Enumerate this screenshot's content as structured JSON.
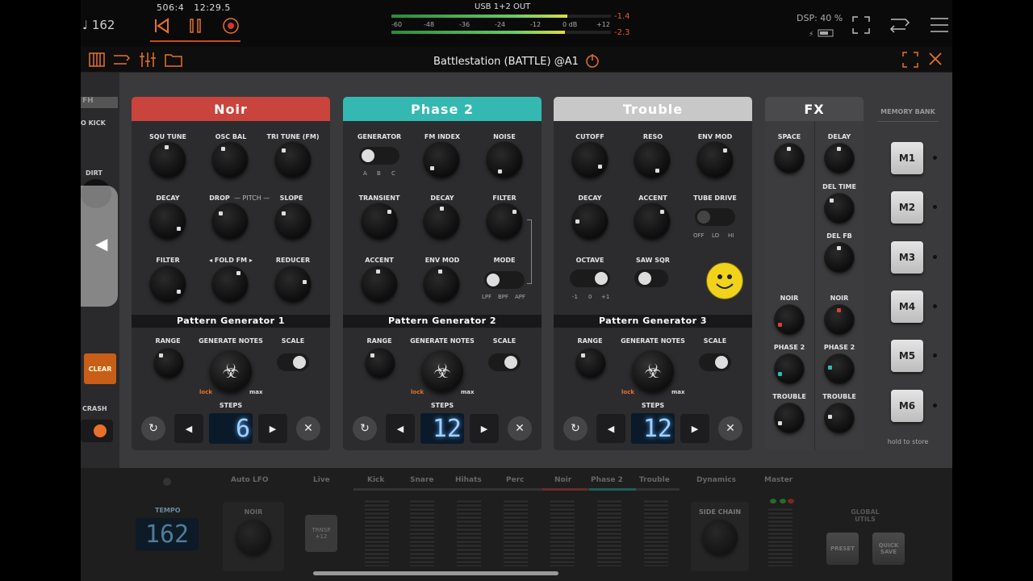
{
  "topbar": {
    "tempo": "♩ 162",
    "position": "506:4",
    "time": "12:29.5",
    "output_label": "USB 1+2 OUT",
    "meter_scale": [
      "-60",
      "-48",
      "-36",
      "-24",
      "-12",
      "0 dB",
      "+12"
    ],
    "peak_left": "-1.4",
    "peak_right": "-2.3",
    "dsp": "DSP: 40 %"
  },
  "plugin": {
    "title": "Battlestation (BATTLE) @A1"
  },
  "left": {
    "fh": "FH",
    "kick": "O KICK",
    "dirt": "DIRT",
    "clear": "CLEAR",
    "crash": "CRASH"
  },
  "noir": {
    "title": "Noir",
    "knobs": [
      "SQU TUNE",
      "OSC BAL",
      "TRI TUNE (FM)",
      "DECAY",
      "DROP",
      "PITCH",
      "SLOPE",
      "FILTER",
      "◂ FOLD  FM ▸",
      "REDUCER"
    ],
    "pg_title": "Pattern Generator 1",
    "range": "RANGE",
    "generate": "GENERATE NOTES",
    "scale": "SCALE",
    "lock": "lock",
    "max": "max",
    "steps_label": "STEPS",
    "steps": "6"
  },
  "phase2": {
    "title": "Phase 2",
    "knobs": [
      "GENERATOR",
      "FM INDEX",
      "NOISE",
      "TRANSIENT",
      "DECAY",
      "FILTER",
      "ACCENT",
      "ENV MOD",
      "MODE"
    ],
    "gen_opts": [
      "A",
      "B",
      "C"
    ],
    "mode_opts": [
      "LPF",
      "BPF",
      "APF"
    ],
    "pg_title": "Pattern Generator 2",
    "range": "RANGE",
    "generate": "GENERATE NOTES",
    "scale": "SCALE",
    "lock": "lock",
    "max": "max",
    "steps_label": "STEPS",
    "steps": "12"
  },
  "trouble": {
    "title": "Trouble",
    "knobs": [
      "CUTOFF",
      "RESO",
      "ENV MOD",
      "DECAY",
      "ACCENT",
      "TUBE DRIVE",
      "OCTAVE",
      "SAW  SQR"
    ],
    "tube_opts": [
      "OFF",
      "LO",
      "HI"
    ],
    "octave_opts": [
      "-1",
      "0",
      "+1"
    ],
    "pg_title": "Pattern Generator 3",
    "range": "RANGE",
    "generate": "GENERATE NOTES",
    "scale": "SCALE",
    "lock": "lock",
    "max": "max",
    "steps_label": "STEPS",
    "steps": "12"
  },
  "fx": {
    "title": "FX",
    "left": [
      "SPACE",
      "NOIR",
      "PHASE 2",
      "TROUBLE"
    ],
    "right": [
      "DELAY",
      "DEL TIME",
      "DEL FB",
      "NOIR",
      "PHASE 2",
      "TROUBLE"
    ]
  },
  "memory": {
    "title": "MEMORY BANK",
    "slots": [
      "M1",
      "M2",
      "M3",
      "M4",
      "M5",
      "M6"
    ],
    "hint": "hold to store"
  },
  "bottom": {
    "tabs": [
      "Auto LFO",
      "Live",
      "Kick",
      "Snare",
      "Hihats",
      "Perc",
      "Noir",
      "Phase 2",
      "Trouble",
      "Dynamics",
      "Master"
    ],
    "tempo_label": "TEMPO",
    "tempo": "162",
    "noir": "NOIR",
    "trnsp": "TRNSP +12",
    "side_chain": "SIDE CHAIN",
    "global": "GLOBAL UTILS",
    "preset": "PRESET",
    "quick_save": "QUICK SAVE"
  },
  "colors": {
    "noir": "#c9443c",
    "phase2": "#33b9b2",
    "trouble": "#c8c8c8",
    "accent": "#e8702a",
    "lcd": "#9fd2ff"
  }
}
